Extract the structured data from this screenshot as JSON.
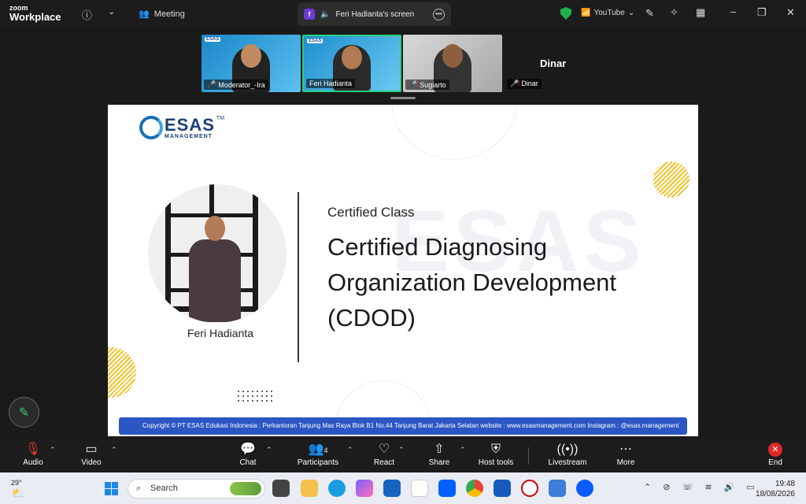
{
  "app": {
    "brand_line1": "zoom",
    "brand_line2": "Workplace"
  },
  "topbar": {
    "meeting_label": "Meeting",
    "share_tab_badge": "f",
    "share_tab_label": "Feri Hadianta's screen",
    "youtube_label": "YouTube",
    "icons": [
      "info-icon",
      "chevron-down-icon",
      "meeting-icon",
      "speaker-icon",
      "more-icon",
      "shield-icon",
      "signal-icon",
      "pen-tool-icon",
      "sparkle-icon",
      "layout-icon",
      "minimize-icon",
      "restore-icon",
      "close-icon"
    ]
  },
  "participants": [
    {
      "name": "Moderator_-Ira",
      "muted": true
    },
    {
      "name": "Feri Hadianta",
      "muted": false
    },
    {
      "name": "Sugiarto",
      "muted": true
    },
    {
      "name": "Dinar",
      "muted": true
    }
  ],
  "slide": {
    "logo_text": "ESAS",
    "logo_tm": "TM",
    "logo_sub": "MANAGEMENT",
    "speaker_name": "Feri Hadianta",
    "eyebrow": "Certified Class",
    "title": "Certified Diagnosing Organization Development (CDOD)",
    "footer": "Copyright © PT ESAS Edukasi Indonesia : Perkantoran Tanjung Mas Raya Blok B1 No.44 Tanjung Barat Jakarta Selatan website : www.esasmanagement.com Instagram : @esas.management",
    "colors": {
      "brand_blue": "#1d3f73",
      "accent_gold": "#f0c22e",
      "footer_blue": "#2b56c4"
    }
  },
  "toolbar": {
    "audio": "Audio",
    "video": "Video",
    "chat": "Chat",
    "participants": "Participants",
    "participants_count": "4",
    "react": "React",
    "share": "Share",
    "host_tools": "Host tools",
    "livestream": "Livestream",
    "more": "More",
    "end": "End"
  },
  "taskbar": {
    "weather_temp": "29°",
    "search_placeholder": "Search",
    "time": "19:48",
    "date": "18/08/2026"
  }
}
